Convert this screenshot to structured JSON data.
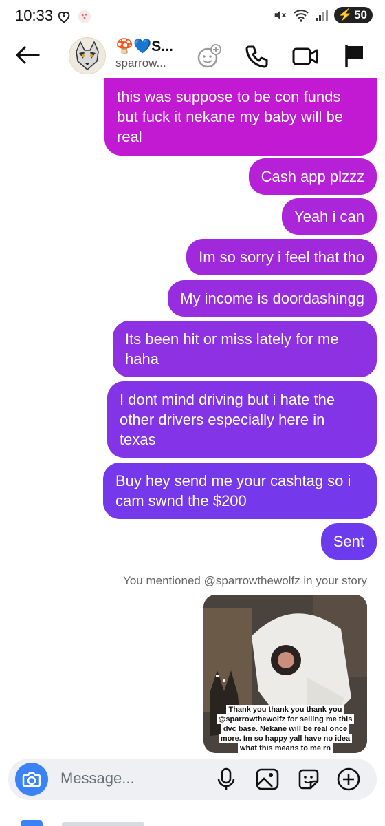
{
  "status_bar": {
    "time": "10:33",
    "battery": "50"
  },
  "header": {
    "contact_name": "🍄💙S...",
    "contact_handle": "sparrow..."
  },
  "messages": [
    {
      "text": "this was suppose to be con funds but fuck it nekane my baby will be real"
    },
    {
      "text": "Cash app plzzz"
    },
    {
      "text": "Yeah i can"
    },
    {
      "text": "Im so sorry i feel that tho"
    },
    {
      "text": "My income is doordashingg"
    },
    {
      "text": "Its been hit or miss lately for me haha"
    },
    {
      "text": "I dont mind driving but i hate the other drivers especially here in texas"
    },
    {
      "text": "Buy hey send me your cashtag so i cam swnd the $200"
    },
    {
      "text": "Sent"
    }
  ],
  "story_notice": "You mentioned @sparrowthewolfz in your story",
  "story": {
    "caption_lines": [
      "Thank you thank you thank you",
      "@sparrowthewolfz for selling me this",
      "dvc base. Nekane will be real once",
      "more. Im so happy yall have no idea",
      "what this means to me rn"
    ]
  },
  "composer": {
    "placeholder": "Message..."
  },
  "colors": {
    "bubble_top": "#c41ad0",
    "bubble_mid": "#9b2ee0",
    "bubble_bottom": "#6a3cf0",
    "composer_camera": "#3b82f6"
  }
}
